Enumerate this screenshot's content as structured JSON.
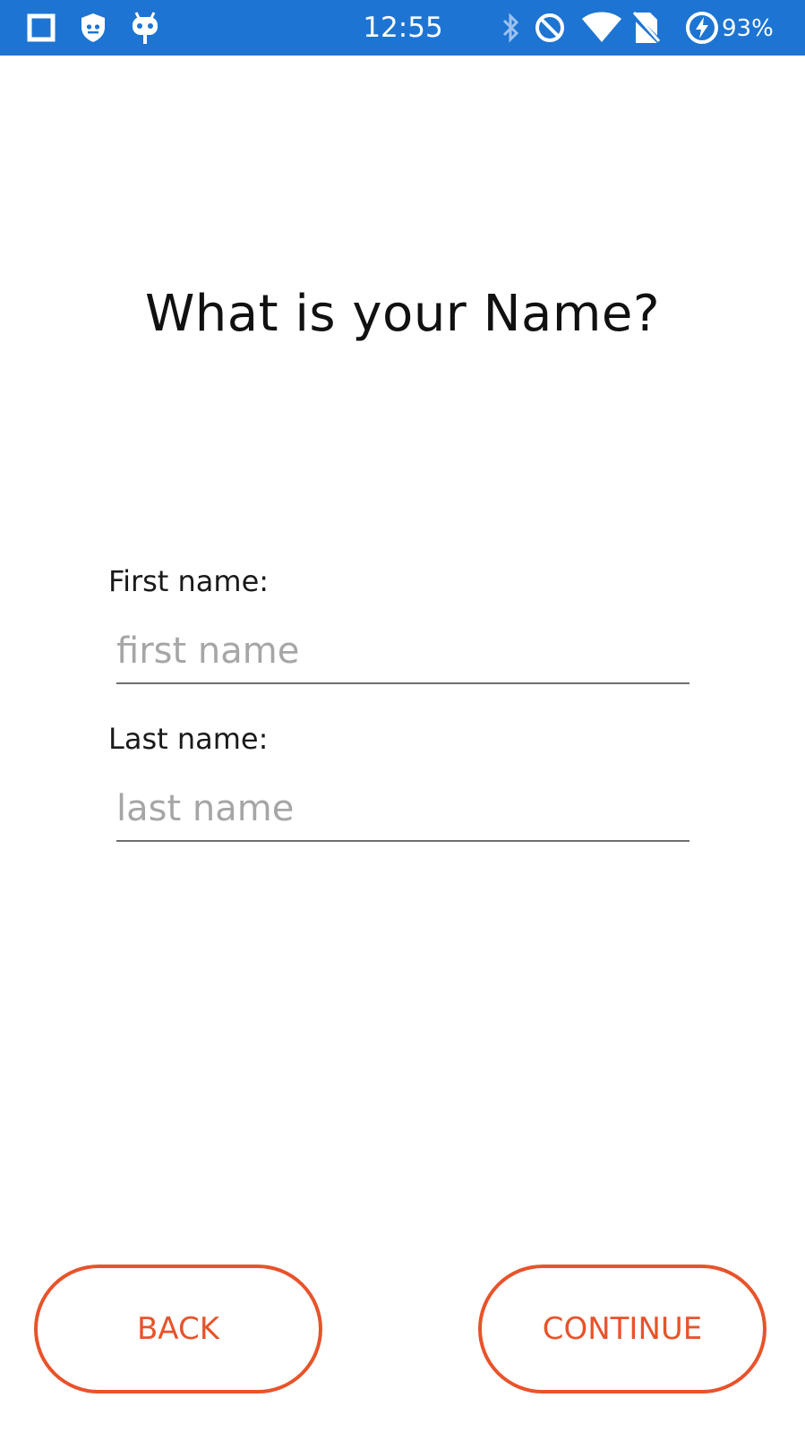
{
  "status_bar": {
    "time": "12:55",
    "battery_text": "93%",
    "left_icons": [
      "square-icon",
      "shield-icon",
      "android-icon"
    ],
    "right_icons": [
      "bluetooth-icon",
      "do-not-disturb-icon",
      "wifi-icon",
      "no-sim-icon",
      "battery-charging-icon"
    ],
    "background_color": "#1e74d2"
  },
  "page": {
    "title": "What is your Name?"
  },
  "form": {
    "first_name": {
      "label": "First name:",
      "placeholder": "first name",
      "value": ""
    },
    "last_name": {
      "label": "Last name:",
      "placeholder": "last name",
      "value": ""
    }
  },
  "buttons": {
    "back_label": "BACK",
    "continue_label": "CONTINUE",
    "accent_color": "#e8532a"
  }
}
